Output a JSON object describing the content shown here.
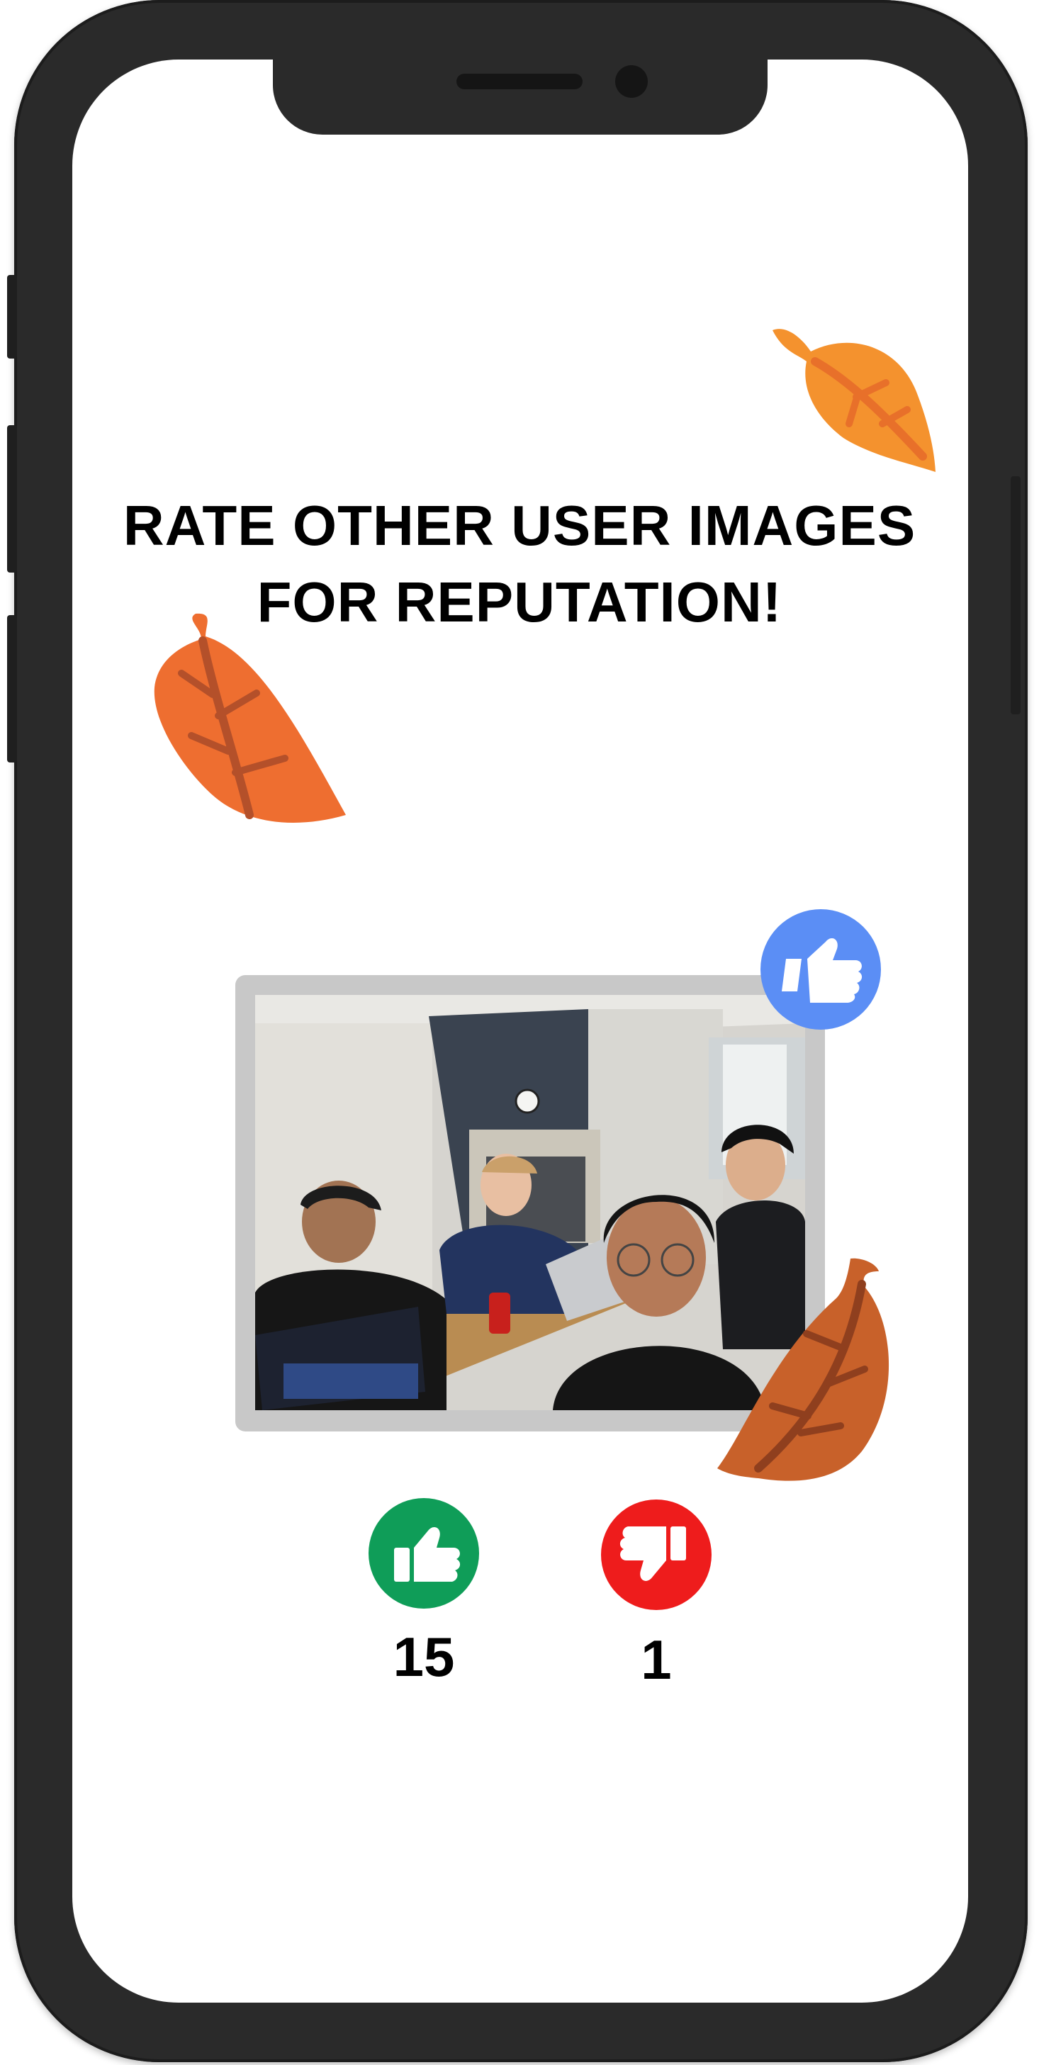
{
  "headline": {
    "line1": "RATE OTHER USER IMAGES",
    "line2": "FOR REPUTATION!"
  },
  "photo": {
    "description_icon": "user-photo"
  },
  "ratings": {
    "likes": "15",
    "dislikes": "1"
  },
  "colors": {
    "phone_frame": "#2a2a2a",
    "like_green": "#0f9d58",
    "dislike_red": "#ee1c1c",
    "badge_blue": "#5b8ef5",
    "leaf_orange": "#f07a2c",
    "leaf_light_orange": "#f4922e",
    "leaf_brown": "#c8612a"
  },
  "icons": {
    "badge": "thumbs-up-icon",
    "like": "thumbs-up-icon",
    "dislike": "thumbs-down-icon",
    "decor": "leaf-icon"
  }
}
